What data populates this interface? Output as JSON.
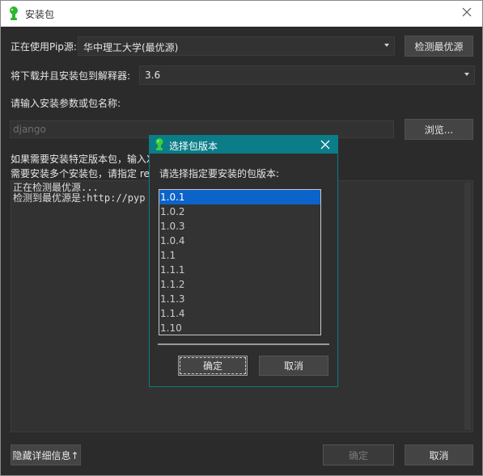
{
  "window": {
    "title": "安装包",
    "icon": "python-green-icon"
  },
  "source_row": {
    "label": "正在使用Pip源:",
    "value": "华中理工大学(最优源)",
    "button": "检测最优源"
  },
  "interpreter_row": {
    "label": "将下载并且安装包到解释器:",
    "value": "3.6"
  },
  "package_input": {
    "label": "请输入安装参数或包名称:",
    "value": "django",
    "browse_button": "浏览..."
  },
  "hints": {
    "line1": "如果需要安装特定版本包，输入X",
    "line2": "需要安装多个安装包，请指定 re"
  },
  "log": {
    "lines": [
      "正在检测最优源...",
      "检测到最优源是:http://pyp"
    ]
  },
  "footer": {
    "toggle_details": "隐藏详细信息↑",
    "ok_button": "确定",
    "cancel_button": "取消"
  },
  "dialog": {
    "title": "选择包版本",
    "prompt": "请选择指定要安装的包版本:",
    "versions": [
      "1.0.1",
      "1.0.2",
      "1.0.3",
      "1.0.4",
      "1.1",
      "1.1.1",
      "1.1.2",
      "1.1.3",
      "1.1.4",
      "1.10"
    ],
    "selected_index": 0,
    "ok_button": "确定",
    "cancel_button": "取消",
    "accent_color": "#0a7d88",
    "selection_color": "#0c63c9"
  }
}
